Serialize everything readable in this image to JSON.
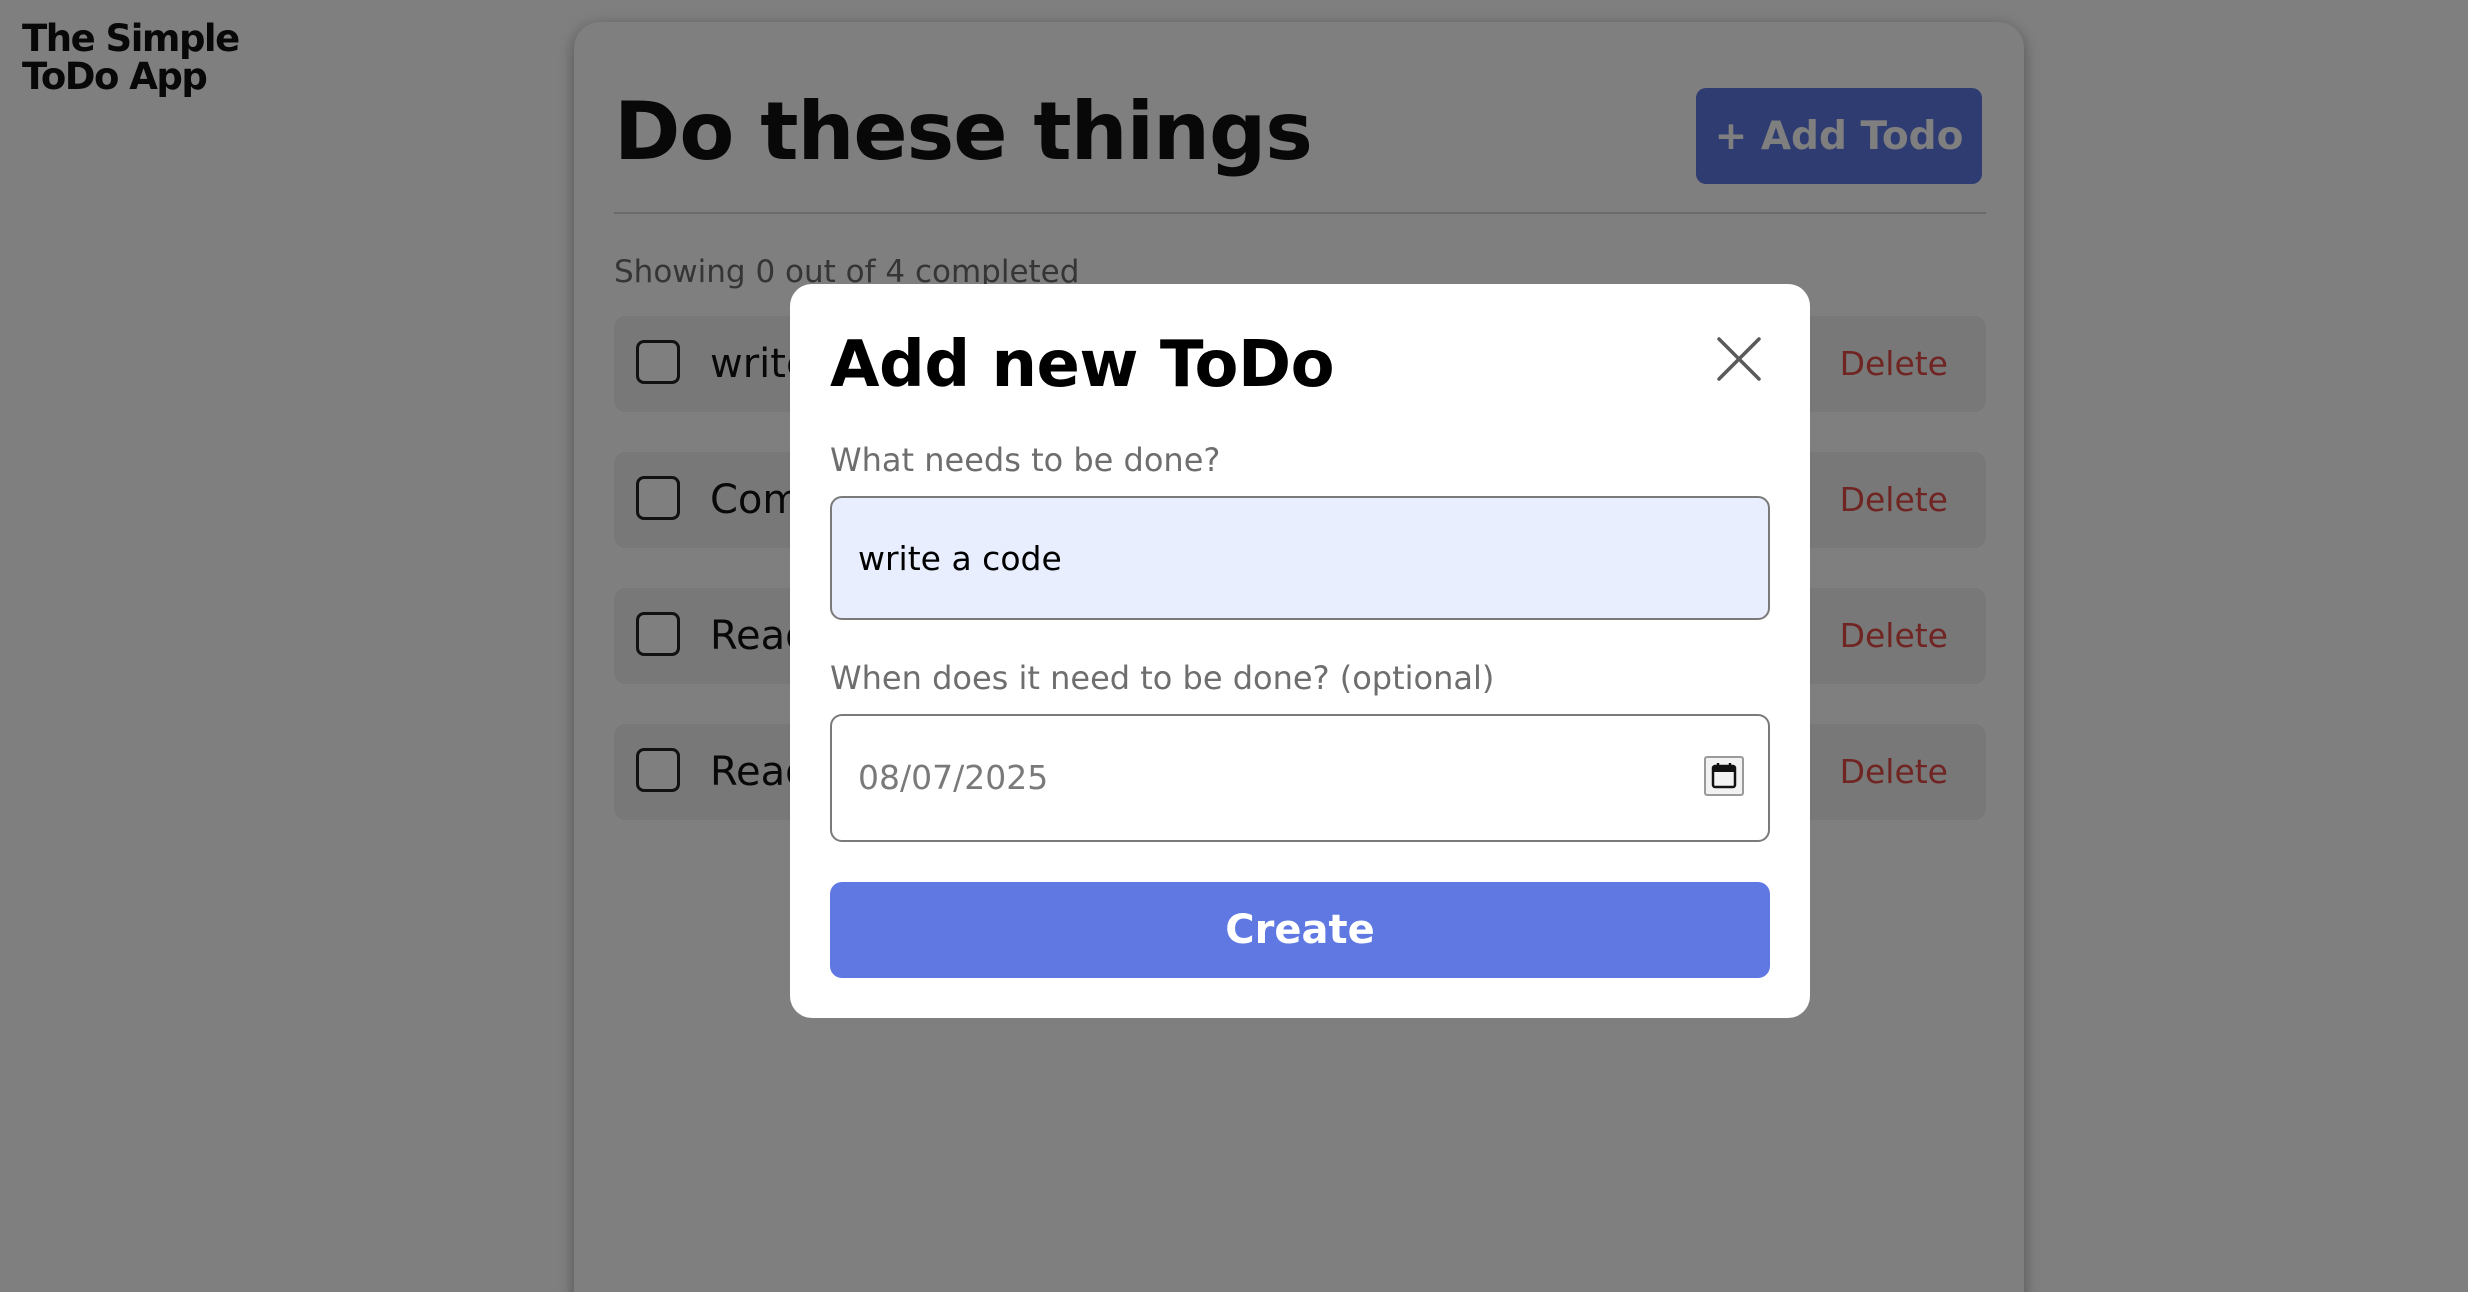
{
  "app": {
    "title_line1": "The Simple",
    "title_line2": "ToDo App"
  },
  "main": {
    "title": "Do these things",
    "add_button_label": "+ Add Todo",
    "completed_summary": "Showing 0 out of 4 completed",
    "todos": [
      {
        "text": "write a code",
        "completed": false,
        "delete_label": "Delete"
      },
      {
        "text": "Complete the project",
        "completed": false,
        "delete_label": "Delete"
      },
      {
        "text": "Read a book",
        "completed": false,
        "delete_label": "Delete"
      },
      {
        "text": "Read the news",
        "completed": false,
        "delete_label": "Delete"
      }
    ]
  },
  "modal": {
    "title": "Add new ToDo",
    "close_icon": "close-icon",
    "task_label": "What needs to be done?",
    "task_value": "write a code",
    "date_label": "When does it need to be done? (optional)",
    "date_value": "08/07/2025",
    "calendar_icon": "calendar-icon",
    "create_label": "Create"
  },
  "colors": {
    "accent": "#5f78e2",
    "danger": "#e04a46",
    "input_fill": "#e8eefe"
  }
}
